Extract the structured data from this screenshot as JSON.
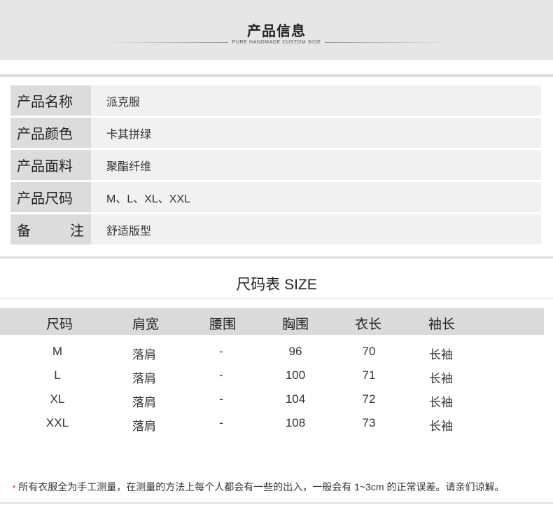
{
  "header": {
    "title": "产品信息",
    "subtitle": "PURE HANDMADE CUSTOM SIDE"
  },
  "info": {
    "rows": [
      {
        "label": "产品名称",
        "value": "派克服"
      },
      {
        "label": "产品颜色",
        "value": "卡其拼绿"
      },
      {
        "label": "产品面料",
        "value": "聚酯纤维"
      },
      {
        "label": "产品尺码",
        "value": "M、L、XL、XXL"
      },
      {
        "label_a": "备",
        "label_b": "注",
        "value": "舒适版型"
      }
    ]
  },
  "size_table": {
    "title": "尺码表 SIZE",
    "headers": [
      "尺码",
      "肩宽",
      "腰围",
      "胸围",
      "衣长",
      "袖长"
    ],
    "rows": [
      [
        "M",
        "落肩",
        "-",
        "96",
        "70",
        "长袖"
      ],
      [
        "L",
        "落肩",
        "-",
        "100",
        "71",
        "长袖"
      ],
      [
        "XL",
        "落肩",
        "-",
        "104",
        "72",
        "长袖"
      ],
      [
        "XXL",
        "落肩",
        "-",
        "108",
        "73",
        "长袖"
      ]
    ]
  },
  "footnote": {
    "star": "*",
    "text": "所有衣服全为手工测量，在测量的方法上每个人都会有一些的出入，一般会有 1~3cm 的正常误差。请亲们谅解。"
  },
  "colors": {
    "header_band": "#e6e6e6",
    "label_cell": "#dcdcdc",
    "value_cell": "#f1f1f1",
    "table_header": "#dadada",
    "star": "#dd2222"
  }
}
